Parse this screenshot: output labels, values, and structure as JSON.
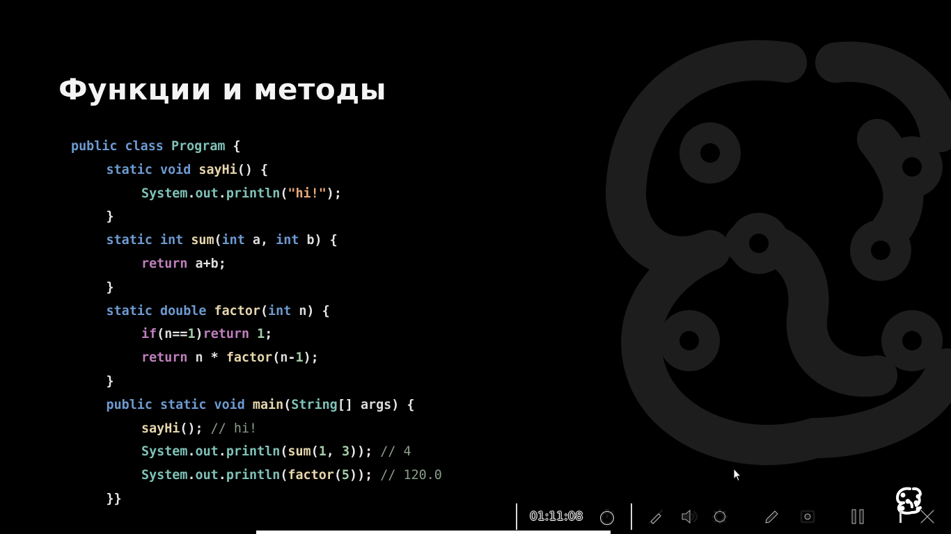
{
  "slide": {
    "title": "Функции и методы"
  },
  "code": {
    "lines": [
      {
        "indent": 0,
        "tokens": [
          [
            "kw",
            "public"
          ],
          [
            "pn",
            " "
          ],
          [
            "kw",
            "class"
          ],
          [
            "pn",
            " "
          ],
          [
            "tp",
            "Program"
          ],
          [
            "pn",
            " {"
          ]
        ]
      },
      {
        "indent": 1,
        "tokens": [
          [
            "kw",
            "static"
          ],
          [
            "pn",
            " "
          ],
          [
            "kw",
            "void"
          ],
          [
            "pn",
            " "
          ],
          [
            "fn",
            "sayHi"
          ],
          [
            "pn",
            "() {"
          ]
        ]
      },
      {
        "indent": 2,
        "tokens": [
          [
            "tp",
            "System"
          ],
          [
            "pn",
            "."
          ],
          [
            "tp",
            "out"
          ],
          [
            "pn",
            "."
          ],
          [
            "tp",
            "println"
          ],
          [
            "pn",
            "("
          ],
          [
            "str",
            "\"hi!\""
          ],
          [
            "pn",
            ");"
          ]
        ]
      },
      {
        "indent": 1,
        "tokens": [
          [
            "pn",
            "}"
          ]
        ]
      },
      {
        "indent": 1,
        "tokens": [
          [
            "kw",
            "static"
          ],
          [
            "pn",
            " "
          ],
          [
            "kw",
            "int"
          ],
          [
            "pn",
            " "
          ],
          [
            "fn",
            "sum"
          ],
          [
            "pn",
            "("
          ],
          [
            "kw",
            "int"
          ],
          [
            "pn",
            " "
          ],
          [
            "id",
            "a"
          ],
          [
            "pn",
            ", "
          ],
          [
            "kw",
            "int"
          ],
          [
            "pn",
            " "
          ],
          [
            "id",
            "b"
          ],
          [
            "pn",
            ") {"
          ]
        ]
      },
      {
        "indent": 2,
        "tokens": [
          [
            "kwr",
            "return"
          ],
          [
            "pn",
            " "
          ],
          [
            "id",
            "a"
          ],
          [
            "pn",
            "+"
          ],
          [
            "id",
            "b"
          ],
          [
            "pn",
            ";"
          ]
        ]
      },
      {
        "indent": 1,
        "tokens": [
          [
            "pn",
            "}"
          ]
        ]
      },
      {
        "indent": 1,
        "tokens": [
          [
            "kw",
            "static"
          ],
          [
            "pn",
            " "
          ],
          [
            "kw",
            "double"
          ],
          [
            "pn",
            " "
          ],
          [
            "fn",
            "factor"
          ],
          [
            "pn",
            "("
          ],
          [
            "kw",
            "int"
          ],
          [
            "pn",
            " "
          ],
          [
            "id",
            "n"
          ],
          [
            "pn",
            ") {"
          ]
        ]
      },
      {
        "indent": 2,
        "tokens": [
          [
            "kwr",
            "if"
          ],
          [
            "pn",
            "("
          ],
          [
            "id",
            "n"
          ],
          [
            "pn",
            "=="
          ],
          [
            "num",
            "1"
          ],
          [
            "pn",
            ")"
          ],
          [
            "kwr",
            "return"
          ],
          [
            "pn",
            " "
          ],
          [
            "num",
            "1"
          ],
          [
            "pn",
            ";"
          ]
        ]
      },
      {
        "indent": 2,
        "tokens": [
          [
            "kwr",
            "return"
          ],
          [
            "pn",
            " "
          ],
          [
            "id",
            "n"
          ],
          [
            "pn",
            " * "
          ],
          [
            "fn",
            "factor"
          ],
          [
            "pn",
            "("
          ],
          [
            "id",
            "n"
          ],
          [
            "pn",
            "-"
          ],
          [
            "num",
            "1"
          ],
          [
            "pn",
            ");"
          ]
        ]
      },
      {
        "indent": 1,
        "tokens": [
          [
            "pn",
            "}"
          ]
        ]
      },
      {
        "indent": 1,
        "tokens": [
          [
            "kw",
            "public"
          ],
          [
            "pn",
            " "
          ],
          [
            "kw",
            "static"
          ],
          [
            "pn",
            " "
          ],
          [
            "kw",
            "void"
          ],
          [
            "pn",
            " "
          ],
          [
            "fn",
            "main"
          ],
          [
            "pn",
            "("
          ],
          [
            "tp",
            "String"
          ],
          [
            "pn",
            "[] "
          ],
          [
            "id",
            "args"
          ],
          [
            "pn",
            ") {"
          ]
        ]
      },
      {
        "indent": 2,
        "tokens": [
          [
            "fn",
            "sayHi"
          ],
          [
            "pn",
            "(); "
          ],
          [
            "cm",
            "// hi!"
          ]
        ]
      },
      {
        "indent": 2,
        "tokens": [
          [
            "tp",
            "System"
          ],
          [
            "pn",
            "."
          ],
          [
            "tp",
            "out"
          ],
          [
            "pn",
            "."
          ],
          [
            "tp",
            "println"
          ],
          [
            "pn",
            "("
          ],
          [
            "fn",
            "sum"
          ],
          [
            "pn",
            "("
          ],
          [
            "num",
            "1"
          ],
          [
            "pn",
            ", "
          ],
          [
            "num",
            "3"
          ],
          [
            "pn",
            "));"
          ],
          [
            "cm",
            " // 4"
          ]
        ]
      },
      {
        "indent": 2,
        "tokens": [
          [
            "tp",
            "System"
          ],
          [
            "pn",
            "."
          ],
          [
            "tp",
            "out"
          ],
          [
            "pn",
            "."
          ],
          [
            "tp",
            "println"
          ],
          [
            "pn",
            "("
          ],
          [
            "fn",
            "factor"
          ],
          [
            "pn",
            "("
          ],
          [
            "num",
            "5"
          ],
          [
            "pn",
            "));"
          ],
          [
            "cm",
            " // 120.0"
          ]
        ]
      },
      {
        "indent": 1,
        "tokens": [
          [
            "pn",
            "}}"
          ]
        ]
      }
    ]
  },
  "player": {
    "time": "01:11:08",
    "icons": [
      "timer-icon",
      "pen-muted-icon",
      "volume-icon",
      "settings-icon",
      "pencil-icon",
      "record-icon",
      "pause-icon",
      "close-icon"
    ]
  },
  "colors": {
    "background": "#000000",
    "title": "#f4f4f4",
    "keyword": "#6d9ad1",
    "keyword_return": "#bf7fbd",
    "type": "#7fc2b8",
    "function": "#e7d7ad",
    "string": "#e6a87a",
    "number": "#a4cdab",
    "comment": "#8b9e8b",
    "logo_watermark": "#1c1c1c"
  }
}
